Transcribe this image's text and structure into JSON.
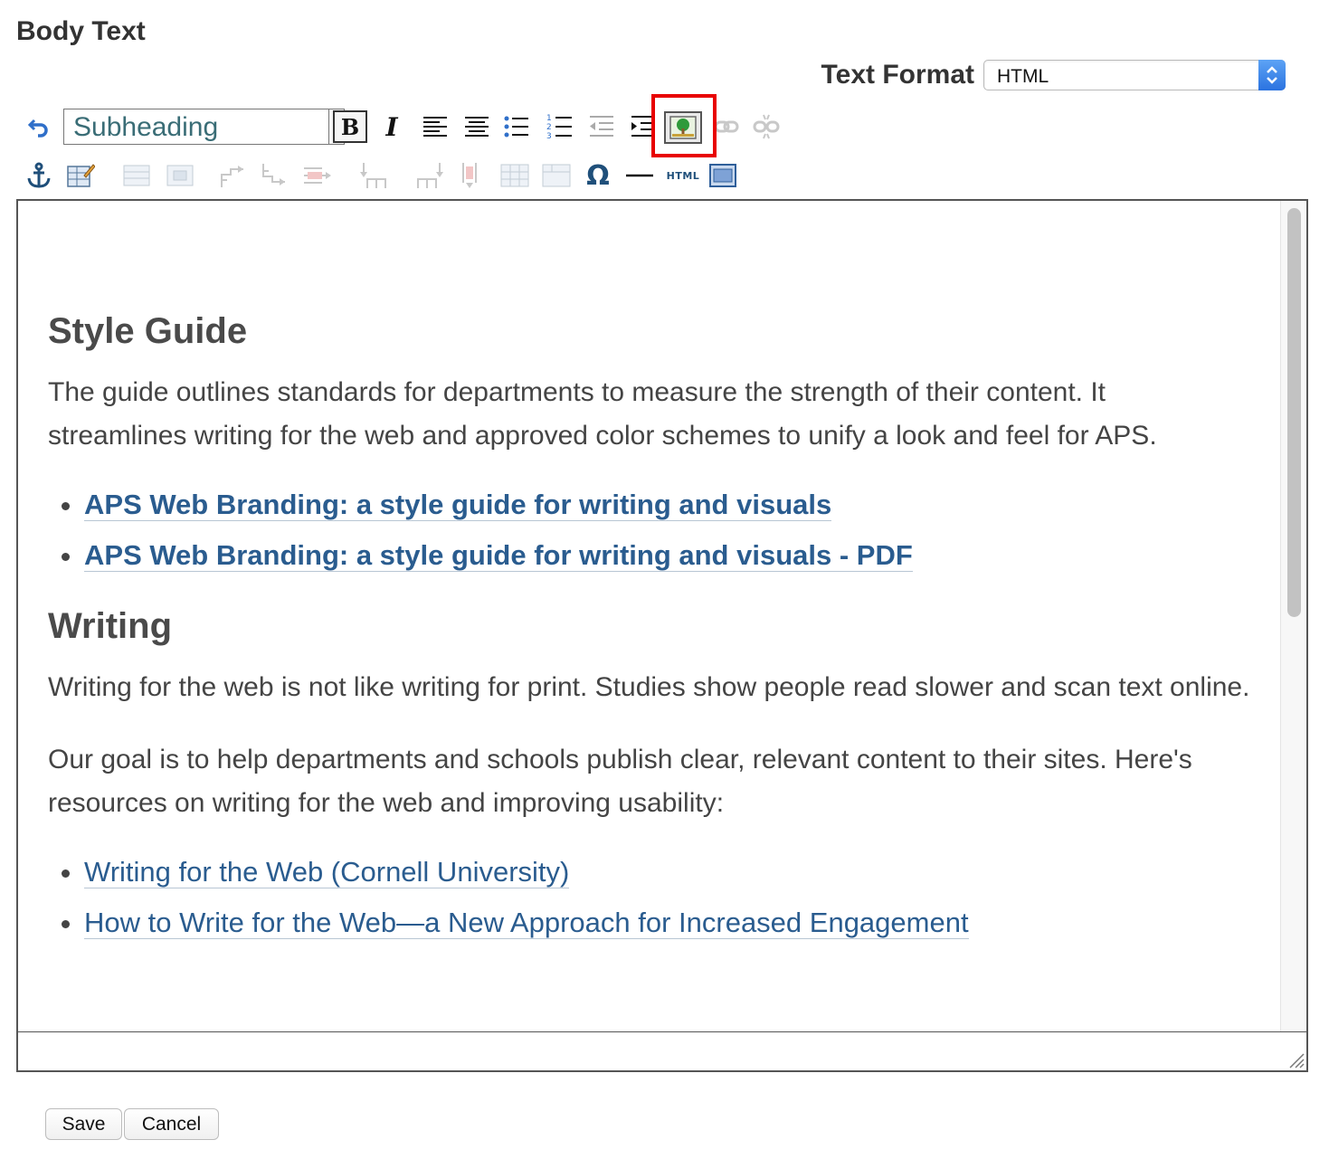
{
  "field_label": "Body Text",
  "text_format": {
    "label": "Text Format",
    "selected": "HTML"
  },
  "toolbar": {
    "style_select": "Subheading",
    "bold": "B",
    "italic": "I",
    "omega": "Ω",
    "html_label": "HTML"
  },
  "content": {
    "h_style_guide": "Style Guide",
    "p_style_guide": "The guide outlines standards for departments to measure the strength of their content. It streamlines writing for the web and approved color schemes to unify a look and feel for APS.",
    "style_links": [
      "APS Web Branding: a style guide for writing and visuals",
      "APS Web Branding: a style guide for writing and visuals - PDF"
    ],
    "h_writing": "Writing",
    "p_writing_1": "Writing for the web is not like writing for print. Studies show people read slower and scan text online.",
    "p_writing_2": "Our goal is to help departments and schools publish clear, relevant content to their sites. Here's resources on writing for the web and improving usability:",
    "writing_links": [
      "Writing for the Web (Cornell University)",
      "How to Write for the Web—a New Approach for Increased Engagement"
    ]
  },
  "buttons": {
    "save": "Save",
    "cancel": "Cancel"
  },
  "colors": {
    "link": "#2a5c8f",
    "highlight": "#e80000",
    "heading": "#4a4a4a"
  }
}
